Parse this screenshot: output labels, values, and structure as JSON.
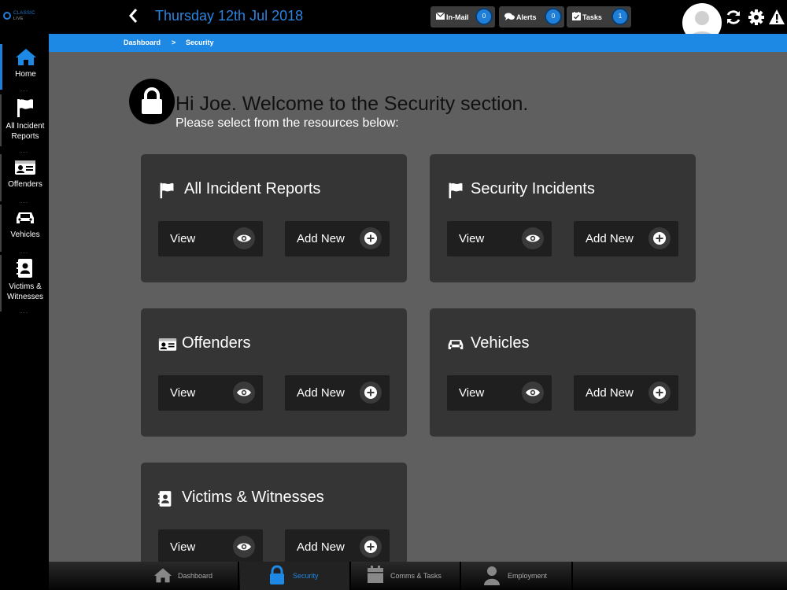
{
  "app": {
    "logo_text": "CLASSIC",
    "logo_subtext": "LIVE"
  },
  "sidebar": {
    "items": [
      {
        "label": "Home",
        "icon": "home-icon"
      },
      {
        "label": "All Incident Reports",
        "icon": "flag-icon"
      },
      {
        "label": "Offenders",
        "icon": "id-card-icon"
      },
      {
        "label": "Vehicles",
        "icon": "car-icon"
      },
      {
        "label": "Victims & Witnesses",
        "icon": "contact-book-icon"
      }
    ],
    "dots": "..."
  },
  "header": {
    "date": "Thursday 12th Jul 2018",
    "inmail": {
      "label": "In-Mail",
      "count": "0"
    },
    "alerts": {
      "label": "Alerts",
      "count": "0"
    },
    "tasks": {
      "label": "Tasks",
      "count": "1"
    }
  },
  "breadcrumb": {
    "items": [
      "Dashboard",
      "Security"
    ],
    "separator": ">"
  },
  "welcome": {
    "title": "Hi Joe. Welcome to the Security section.",
    "subtitle": "Please select from the resources below:"
  },
  "cards": [
    {
      "title": "All Incident Reports",
      "icon": "flag-icon",
      "view_label": "View",
      "add_label": "Add New"
    },
    {
      "title": "Security Incidents",
      "icon": "flag-icon",
      "view_label": "View",
      "add_label": "Add New"
    },
    {
      "title": "Offenders",
      "icon": "id-card-icon",
      "view_label": "View",
      "add_label": "Add New"
    },
    {
      "title": "Vehicles",
      "icon": "car-icon",
      "view_label": "View",
      "add_label": "Add New"
    },
    {
      "title": "Victims & Witnesses",
      "icon": "contact-book-icon",
      "view_label": "View",
      "add_label": "Add New"
    }
  ],
  "tabs": [
    {
      "label": "Dashboard",
      "icon": "home-icon"
    },
    {
      "label": "Security",
      "icon": "lock-icon",
      "active": true
    },
    {
      "label": "Comms & Tasks",
      "icon": "calendar-icon"
    },
    {
      "label": "Employment",
      "icon": "person-icon"
    }
  ],
  "colors": {
    "accent": "#1e88e5",
    "date_text": "#2a84e0",
    "card_bg": "#353535",
    "main_bg": "#5f5f5f"
  }
}
